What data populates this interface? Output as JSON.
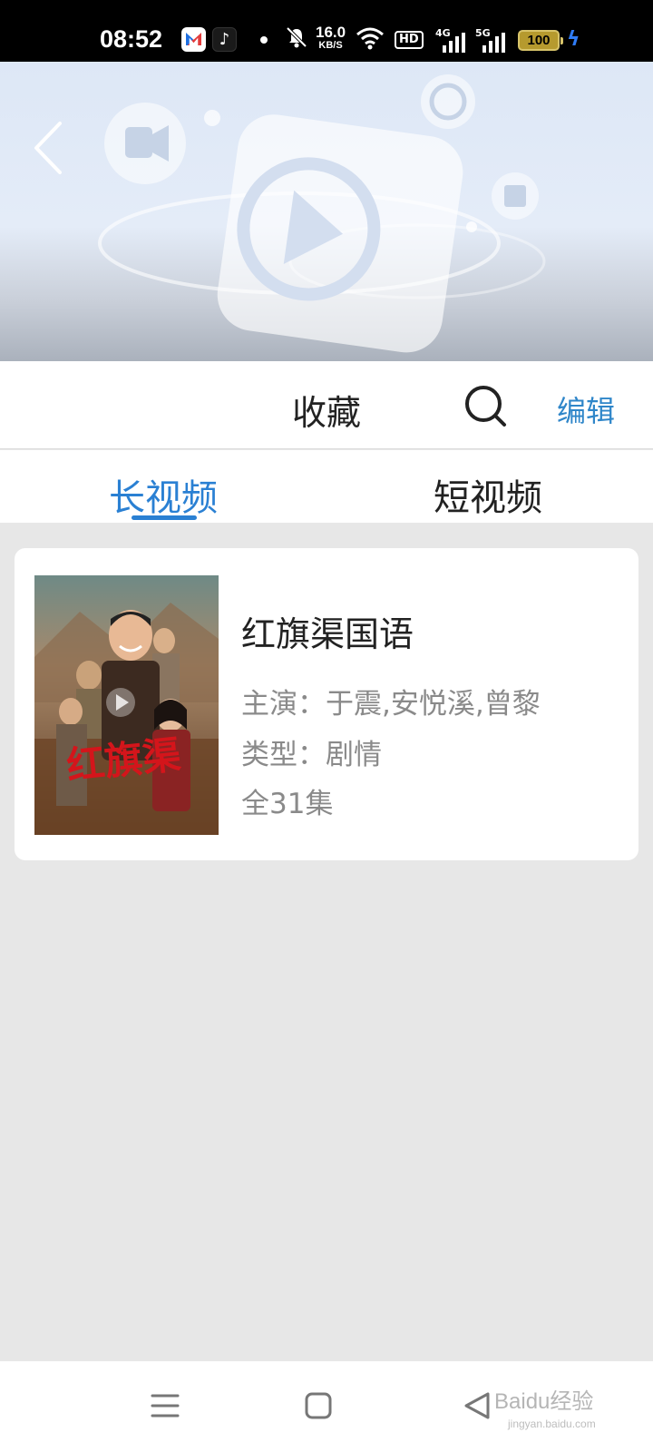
{
  "status_bar": {
    "time": "08:52",
    "net_speed_value": "16.0",
    "net_speed_unit": "KB/S",
    "hd_label": "HD",
    "network_4g": "4G",
    "network_5g": "5G",
    "battery": "100",
    "app_icons": [
      "app-notification-icon",
      "tiktok-icon"
    ],
    "status_icons": [
      "mute-icon",
      "wifi-icon",
      "signal-icon",
      "battery-icon",
      "charging-icon"
    ]
  },
  "header": {
    "title": "收藏",
    "edit_label": "编辑",
    "back_icon": "chevron-left-icon",
    "search_icon": "search-icon"
  },
  "tabs": [
    {
      "label": "长视频",
      "active": true
    },
    {
      "label": "短视频",
      "active": false
    }
  ],
  "favorites": [
    {
      "title": "红旗渠国语",
      "cast": "主演：于震,安悦溪,曾黎",
      "genre": "类型：剧情",
      "episodes": "全31集",
      "poster_text": "红旗渠"
    }
  ],
  "nav_bar": {
    "buttons": [
      "menu-icon",
      "home-icon",
      "back-triangle-icon"
    ]
  },
  "watermark": {
    "text": "Baidu经验",
    "sub": "jingyan.baidu.com"
  },
  "colors": {
    "accent": "#2a80d3",
    "edit_link": "#2f86c9",
    "background": "#e7e7e7"
  }
}
